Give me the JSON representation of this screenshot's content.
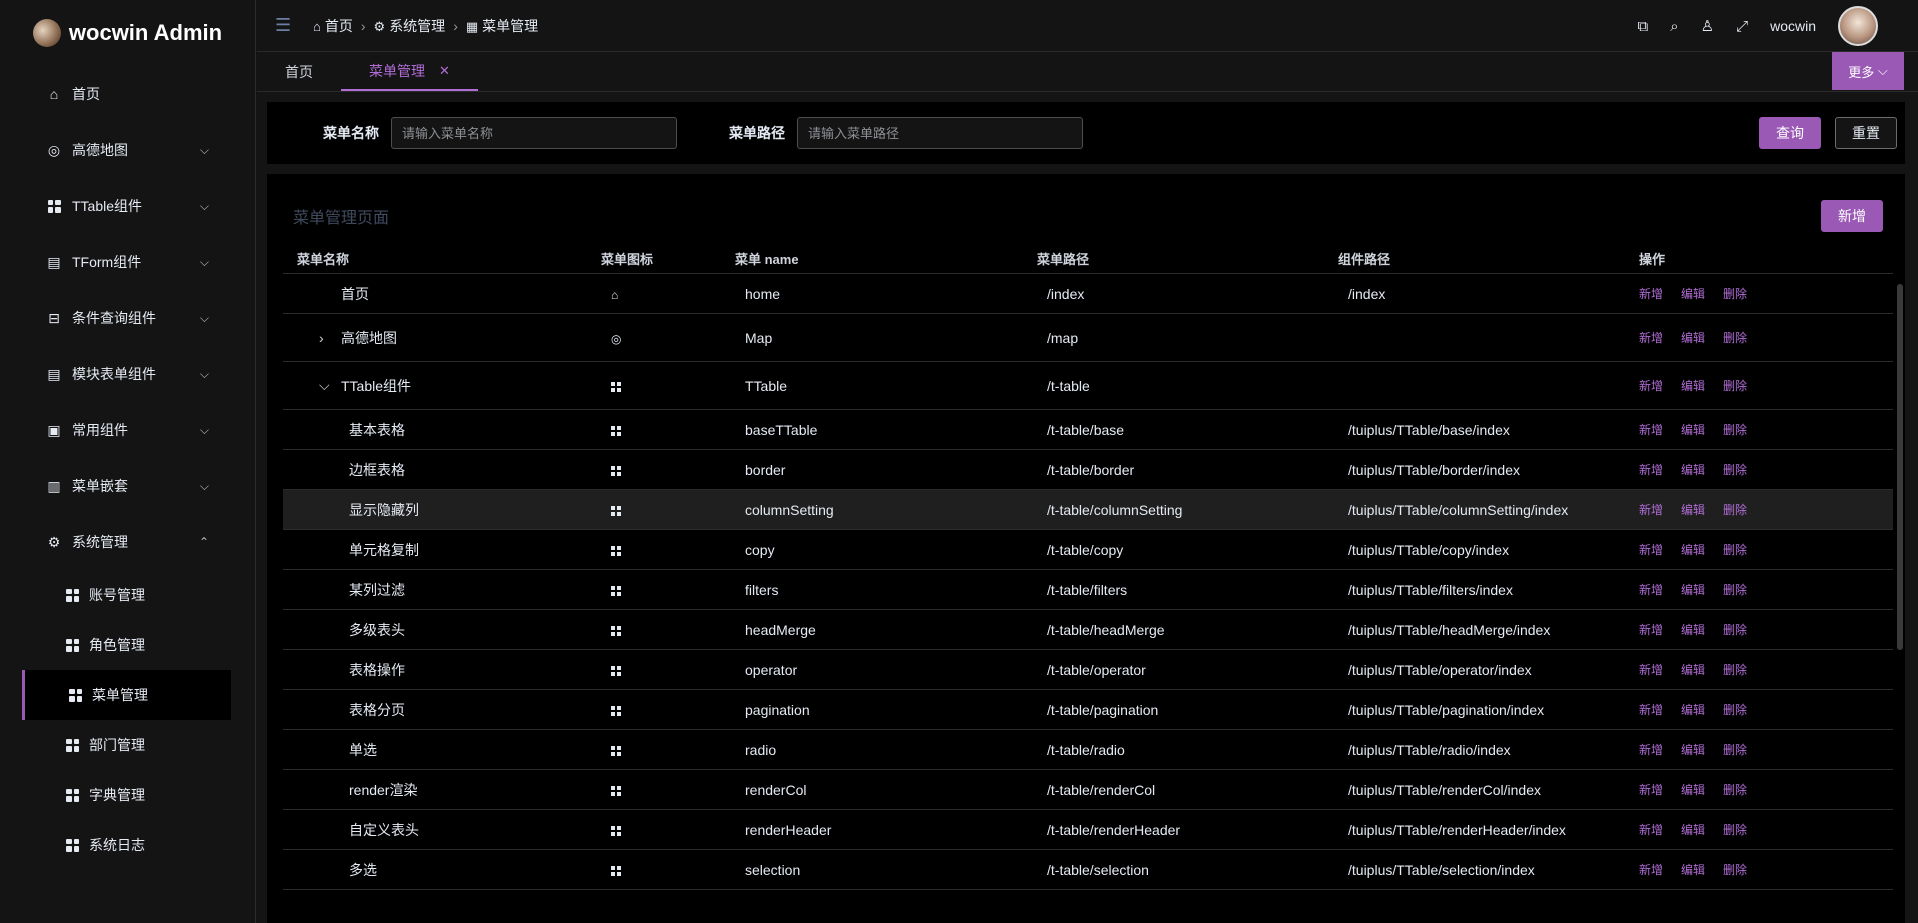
{
  "app": {
    "logo_text": "wocwin Admin",
    "user_name": "wocwin"
  },
  "sidebar": {
    "items": [
      {
        "label": "首页",
        "icon": "home-icon"
      },
      {
        "label": "高德地图",
        "icon": "map-pin-icon"
      },
      {
        "label": "TTable组件",
        "icon": "grid-icon"
      },
      {
        "label": "TForm组件",
        "icon": "document-icon"
      },
      {
        "label": "条件查询组件",
        "icon": "inbox-icon"
      },
      {
        "label": "模块表单组件",
        "icon": "document-icon"
      },
      {
        "label": "常用组件",
        "icon": "briefcase-icon"
      },
      {
        "label": "菜单嵌套",
        "icon": "clipboard-icon"
      },
      {
        "label": "系统管理",
        "icon": "gear-icon"
      }
    ],
    "sub_items": [
      {
        "label": "账号管理"
      },
      {
        "label": "角色管理"
      },
      {
        "label": "菜单管理"
      },
      {
        "label": "部门管理"
      },
      {
        "label": "字典管理"
      },
      {
        "label": "系统日志"
      }
    ]
  },
  "breadcrumb": [
    "首页",
    "系统管理",
    "菜单管理"
  ],
  "tabs": [
    {
      "label": "首页"
    },
    {
      "label": "菜单管理"
    }
  ],
  "tabs_more": "更多",
  "search": {
    "name_label": "菜单名称",
    "name_placeholder": "请输入菜单名称",
    "path_label": "菜单路径",
    "path_placeholder": "请输入菜单路径",
    "query_btn": "查询",
    "reset_btn": "重置"
  },
  "panel": {
    "title": "菜单管理页面",
    "add_btn": "新增"
  },
  "table": {
    "headers": [
      "菜单名称",
      "菜单图标",
      "菜单 name",
      "菜单路径",
      "组件路径",
      "操作"
    ],
    "ops": [
      "新增",
      "编辑",
      "删除"
    ],
    "rows": [
      {
        "name": "首页",
        "icon": "home",
        "key": "home",
        "path": "/index",
        "component": "/index"
      },
      {
        "name": "高德地图",
        "icon": "map",
        "key": "Map",
        "path": "/map",
        "component": ""
      },
      {
        "name": "TTable组件",
        "icon": "grid",
        "key": "TTable",
        "path": "/t-table",
        "component": ""
      },
      {
        "name": "基本表格",
        "icon": "grid",
        "key": "baseTTable",
        "path": "/t-table/base",
        "component": "/tuiplus/TTable/base/index"
      },
      {
        "name": "边框表格",
        "icon": "grid",
        "key": "border",
        "path": "/t-table/border",
        "component": "/tuiplus/TTable/border/index"
      },
      {
        "name": "显示隐藏列",
        "icon": "grid",
        "key": "columnSetting",
        "path": "/t-table/columnSetting",
        "component": "/tuiplus/TTable/columnSetting/index"
      },
      {
        "name": "单元格复制",
        "icon": "grid",
        "key": "copy",
        "path": "/t-table/copy",
        "component": "/tuiplus/TTable/copy/index"
      },
      {
        "name": "某列过滤",
        "icon": "grid",
        "key": "filters",
        "path": "/t-table/filters",
        "component": "/tuiplus/TTable/filters/index"
      },
      {
        "name": "多级表头",
        "icon": "grid",
        "key": "headMerge",
        "path": "/t-table/headMerge",
        "component": "/tuiplus/TTable/headMerge/index"
      },
      {
        "name": "表格操作",
        "icon": "grid",
        "key": "operator",
        "path": "/t-table/operator",
        "component": "/tuiplus/TTable/operator/index"
      },
      {
        "name": "表格分页",
        "icon": "grid",
        "key": "pagination",
        "path": "/t-table/pagination",
        "component": "/tuiplus/TTable/pagination/index"
      },
      {
        "name": "单选",
        "icon": "grid",
        "key": "radio",
        "path": "/t-table/radio",
        "component": "/tuiplus/TTable/radio/index"
      },
      {
        "name": "render渲染",
        "icon": "grid",
        "key": "renderCol",
        "path": "/t-table/renderCol",
        "component": "/tuiplus/TTable/renderCol/index"
      },
      {
        "name": "自定义表头",
        "icon": "grid",
        "key": "renderHeader",
        "path": "/t-table/renderHeader",
        "component": "/tuiplus/TTable/renderHeader/index"
      },
      {
        "name": "多选",
        "icon": "grid",
        "key": "selection",
        "path": "/t-table/selection",
        "component": "/tuiplus/TTable/selection/index"
      }
    ]
  },
  "colors": {
    "accent": "#9b59b6",
    "link": "#b16dd6",
    "bg": "#141414"
  }
}
